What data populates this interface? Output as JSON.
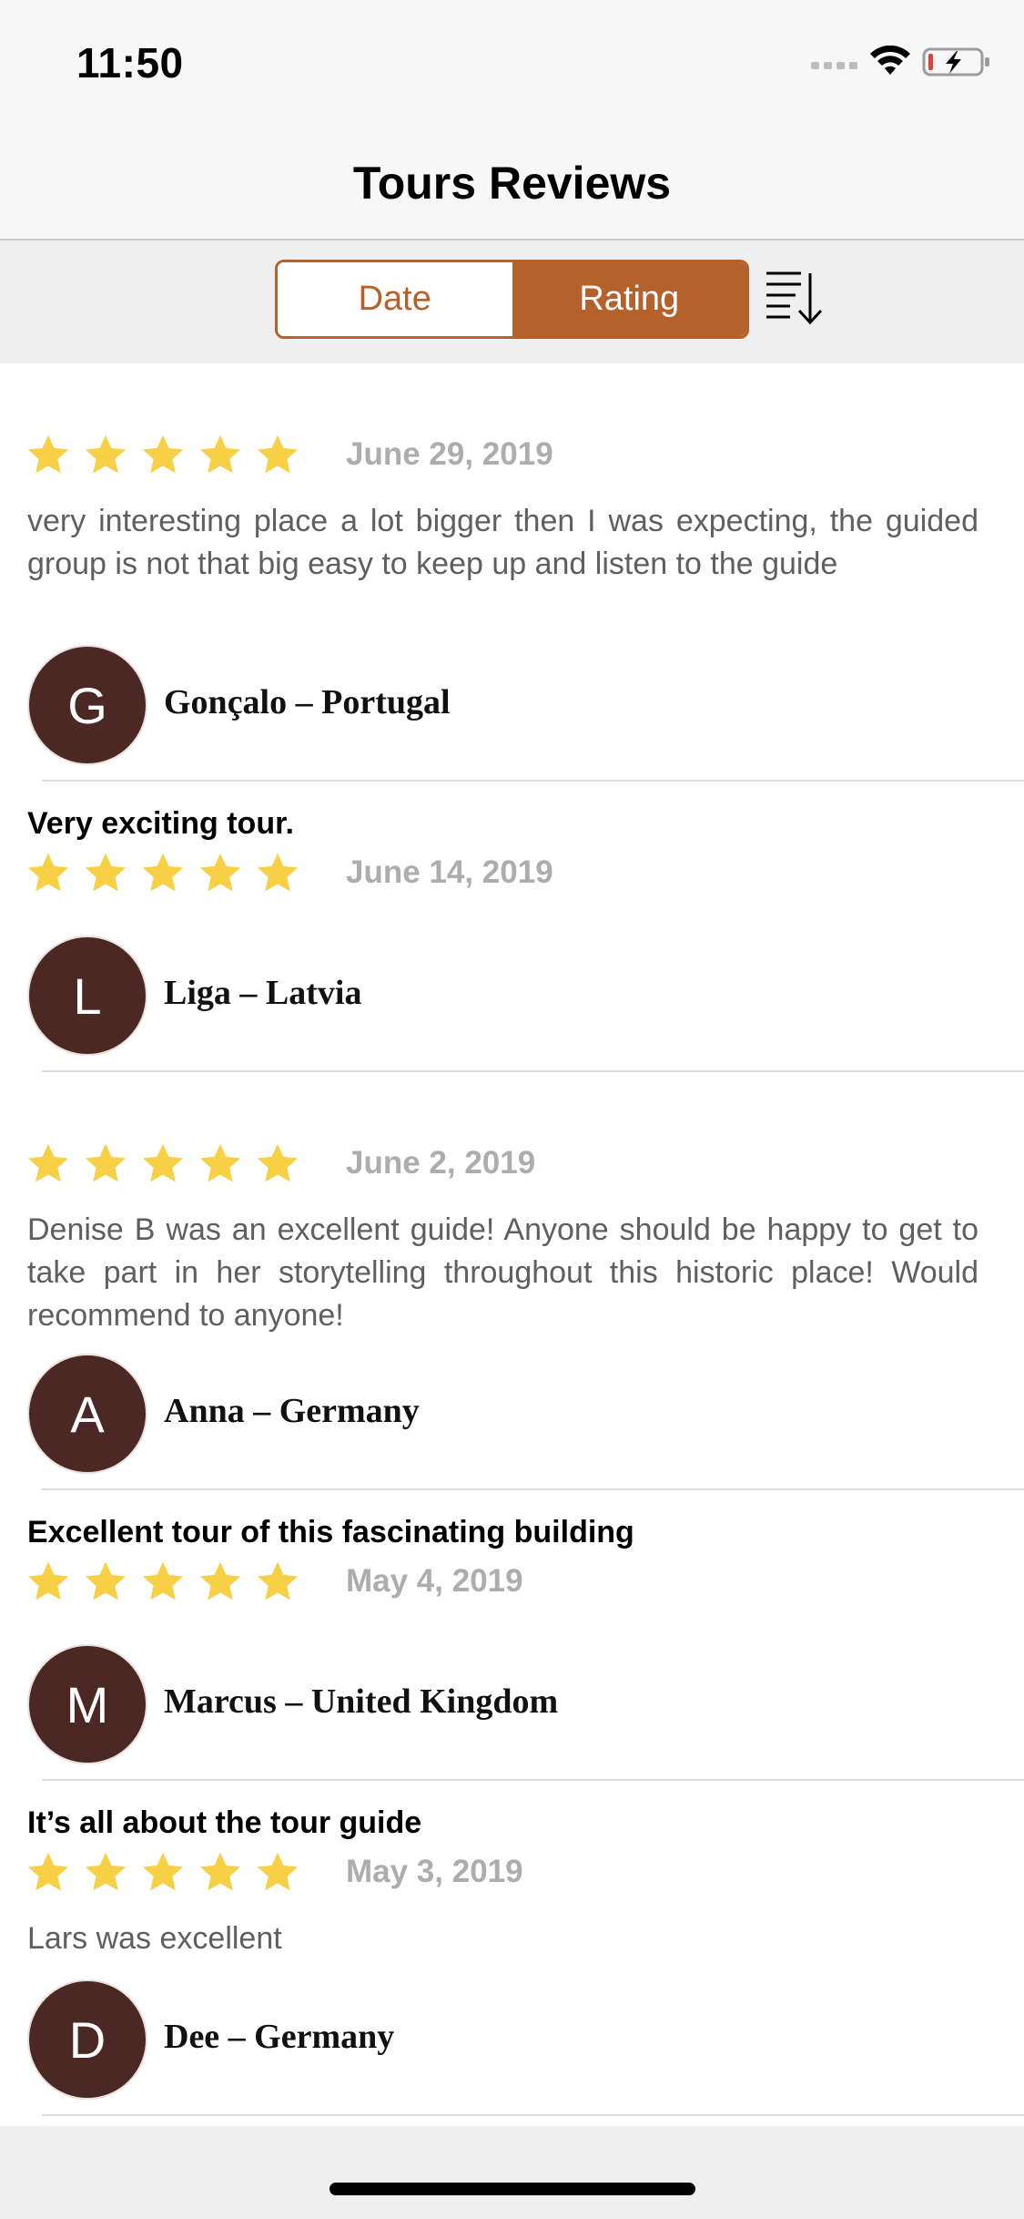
{
  "status_bar": {
    "time": "11:50",
    "icons": [
      "signal-dots-icon",
      "wifi-icon",
      "battery-charging-icon"
    ]
  },
  "nav": {
    "title": "Tours Reviews"
  },
  "sort_control": {
    "segments": [
      "Date",
      "Rating"
    ],
    "selected": "Rating",
    "sort_icon": "sort-descending-icon"
  },
  "colors": {
    "accent": "#b5612b",
    "star": "#f7d046",
    "avatar": "#4b2823",
    "date_text": "#adadad",
    "body_text": "#5f5f5f"
  },
  "reviews": [
    {
      "title": "",
      "rating": 5,
      "date": "June 29, 2019",
      "body": "very interesting place a lot bigger then I was expecting, the guided group is not that big easy to keep up and listen to the guide",
      "initial": "G",
      "author": "Gonçalo – Portugal"
    },
    {
      "title": "Very exciting tour.",
      "rating": 5,
      "date": "June 14, 2019",
      "body": "",
      "initial": "L",
      "author": "Liga – Latvia"
    },
    {
      "title": "",
      "rating": 5,
      "date": "June 2, 2019",
      "body": "Denise B was an excellent guide! Anyone should be happy to get to take part in her storytelling throughout this historic place! Would recommend to anyone!",
      "initial": "A",
      "author": "Anna – Germany"
    },
    {
      "title": "Excellent tour of this fascinating building",
      "rating": 5,
      "date": "May 4, 2019",
      "body": "",
      "initial": "M",
      "author": "Marcus – United Kingdom"
    },
    {
      "title": "It’s all about the tour guide",
      "rating": 5,
      "date": "May 3, 2019",
      "body": "Lars was excellent",
      "initial": "D",
      "author": "Dee – Germany"
    }
  ]
}
